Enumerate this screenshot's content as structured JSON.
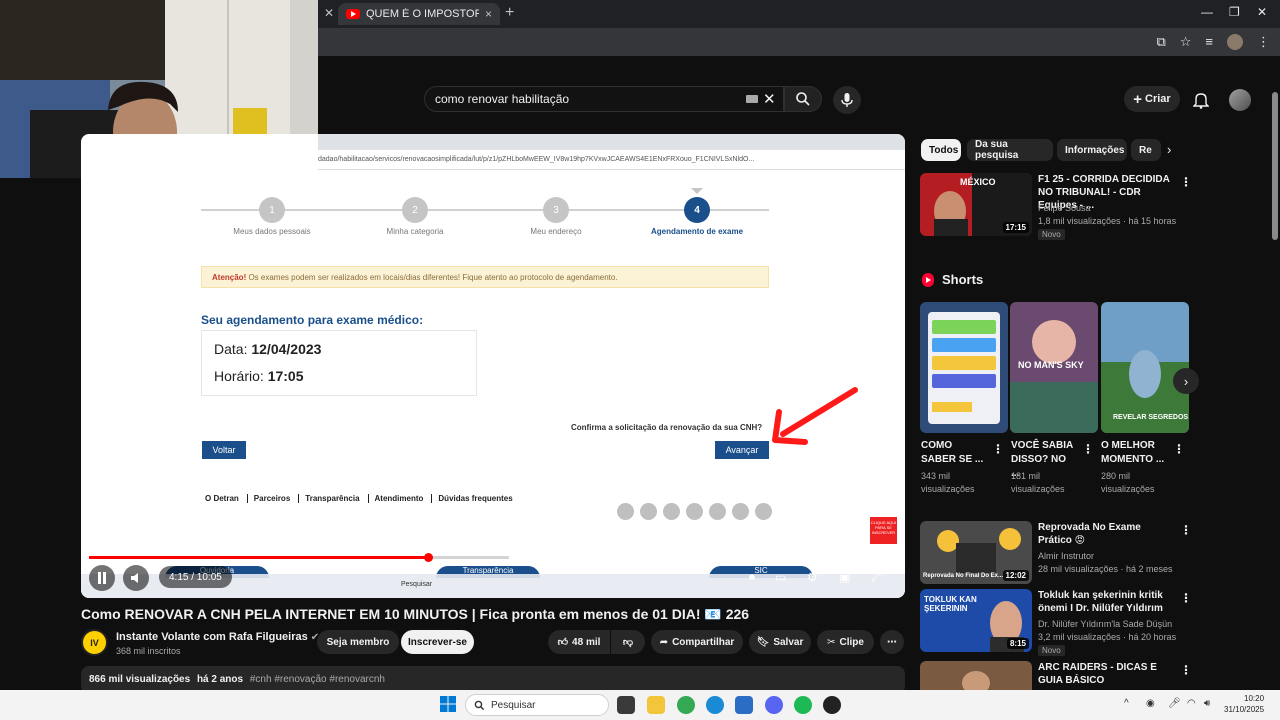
{
  "browser": {
    "tab_title": "QUEM É O IMPOSTOR? - YouTu",
    "tab_close": "×",
    "new_tab": "+"
  },
  "header": {
    "search_query": "como renovar habilitação",
    "create_label": "Criar"
  },
  "video_frame": {
    "inner_url": "dadao/habilitacao/servicos/renovacaosimplificada/lut/p/z1/pZHLboMwEEW_IV8w19hp7KVxwJCAEAWS4E1ENxFRXouo_F1CNIVLSxNldO...",
    "steps": [
      {
        "number": "1",
        "label": "Meus dados pessoais"
      },
      {
        "number": "2",
        "label": "Minha categoria"
      },
      {
        "number": "3",
        "label": "Meu endereço"
      },
      {
        "number": "4",
        "label": "Agendamento de exame"
      }
    ],
    "alert_bold": "Atenção!",
    "alert_text": " Os exames podem ser realizados em locais/dias diferentes! Fique atento ao protocolo de agendamento.",
    "schedule_title": "Seu agendamento para exame médico:",
    "date_label": "Data:",
    "date_value": "12/04/2023",
    "time_label": "Horário:",
    "time_value": "17:05",
    "confirm_question": "Confirma a solicitação da renovação da sua CNH?",
    "back_button": "Voltar",
    "next_button": "Avançar",
    "footer_links": [
      "O Detran",
      "Parceiros",
      "Transparência",
      "Atendimento",
      "Dúvidas frequentes"
    ],
    "subscribe_badge": "CLIQUE AQUI PARA SE INSCREVER",
    "bottom_pills": [
      "Ouvidoria",
      "Transparência",
      "SIC"
    ],
    "inner_search": "Pesquisar"
  },
  "player": {
    "time": "4:15 / 10:05",
    "progress_fraction": 0.42
  },
  "video": {
    "title": "Como RENOVAR A CNH PELA INTERNET EM 10 MINUTOS | Fica pronta em menos de 01 DIA! 📧 226",
    "channel_name": "Instante Volante com Rafa Filgueiras",
    "channel_subs": "368 mil inscritos",
    "join_label": "Seja membro",
    "subscribe_label": "Inscrever-se",
    "likes": "48 mil",
    "share_label": "Compartilhar",
    "save_label": "Salvar",
    "clip_label": "Clipe",
    "views": "866 mil visualizações",
    "age": "há 2 anos",
    "tags": "#cnh #renovação #renovarcnh"
  },
  "sidebar": {
    "chips": [
      "Todos",
      "Da sua pesquisa",
      "Informações",
      "Re"
    ],
    "recs": [
      {
        "title": "F1 25 - CORRIDA DECIDIDA NO TRIBUNAL! - CDR Equipes - ...",
        "channel": "Felipe Sousa",
        "meta": "1,8 mil visualizações · há 15 horas",
        "duration": "17:15",
        "badge": "Novo"
      },
      {
        "title": "Reprovada No Exame Prático 😡",
        "channel": "Almir Instrutor",
        "meta": "28 mil visualizações · há 2 meses",
        "duration": "12:02",
        "badge": ""
      },
      {
        "title": "Tokluk kan şekerinin kritik önemi I Dr. Nilüfer Yıldırım",
        "channel": "Dr. Nilüfer Yıldırım'la Sade Düşün",
        "meta": "3,2 mil visualizações · há 20 horas",
        "duration": "8:15",
        "badge": "Novo"
      },
      {
        "title": "ARC RAIDERS - DICAS E GUIA BÁSICO",
        "channel": "",
        "meta": "",
        "duration": "",
        "badge": ""
      }
    ],
    "shorts_heading": "Shorts",
    "shorts": [
      {
        "title": "COMO SABER SE ...",
        "views": "343 mil visualizações"
      },
      {
        "title": "VOCÊ SABIA DISSO? NO ...",
        "views": "181 mil visualizações"
      },
      {
        "title": "O MELHOR MOMENTO ...",
        "views": "280 mil visualizações"
      }
    ],
    "short_overlay_2": "NO MAN'S SKY",
    "short_overlay_3": "REVELAR SEGREDOS",
    "rec1_thumb_text": "MÉXICO",
    "rec2_thumb_text": "Reprovada No Final Do Ex...",
    "rec3_thumb_text": "TOKLUK KAN ŞEKERININ"
  },
  "taskbar": {
    "search_label": "Pesquisar",
    "time": "10:20",
    "date": "31/10/2025"
  }
}
